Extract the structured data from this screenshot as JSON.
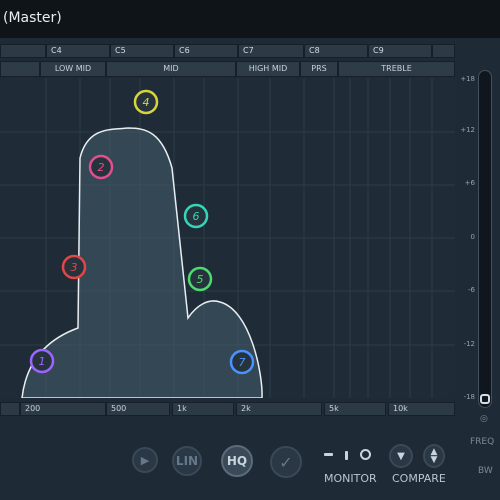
{
  "window": {
    "title": "(Master)"
  },
  "notes": [
    "C4",
    "C5",
    "C6",
    "C7",
    "C8",
    "C9"
  ],
  "bands": [
    "LOW MID",
    "MID",
    "HIGH MID",
    "PRS",
    "TREBLE"
  ],
  "db_scale": [
    "+18",
    "+12",
    "+6",
    "0",
    "-6",
    "-12",
    "-18"
  ],
  "freq_labels": [
    "200",
    "500",
    "1k",
    "2k",
    "5k",
    "10k"
  ],
  "nodes": [
    {
      "label": "1",
      "color": "#9a66ff"
    },
    {
      "label": "2",
      "color": "#e0508f"
    },
    {
      "label": "3",
      "color": "#e24646"
    },
    {
      "label": "4",
      "color": "#d6d63c"
    },
    {
      "label": "5",
      "color": "#4ddb70"
    },
    {
      "label": "6",
      "color": "#37d6b8"
    },
    {
      "label": "7",
      "color": "#4a92ff"
    }
  ],
  "toolbar": {
    "lin": "LIN",
    "hq": "HQ",
    "monitor": "MONITOR",
    "compare": "COMPARE"
  },
  "side": {
    "freq": "FREQ",
    "bw": "BW"
  }
}
